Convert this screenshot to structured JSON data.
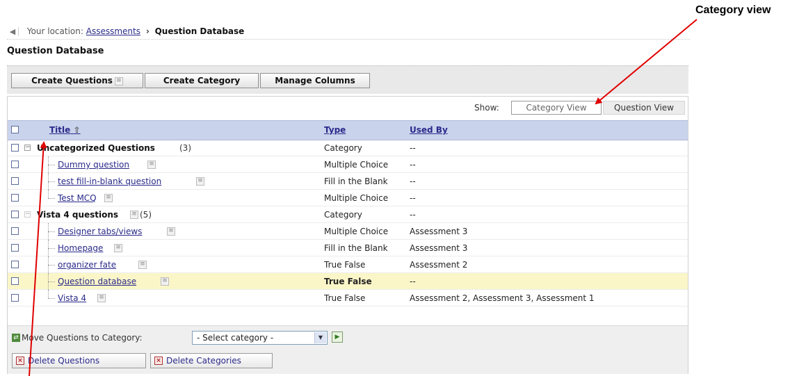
{
  "breadcrumb": {
    "prefix": "Your location:",
    "parent": "Assessments",
    "separator": "›",
    "current": "Question Database"
  },
  "page_title": "Question Database",
  "toolbar": {
    "create_questions": "Create Questions",
    "create_category": "Create Category",
    "manage_columns": "Manage Columns"
  },
  "show": {
    "label": "Show:",
    "category_view": "Category View",
    "question_view": "Question View"
  },
  "columns": {
    "title": "Title",
    "type": "Type",
    "used_by": "Used By"
  },
  "rows": [
    {
      "title": "Uncategorized Questions",
      "count": "(3)",
      "type": "Category",
      "used_by": "--"
    },
    {
      "title": "Dummy question",
      "type": "Multiple Choice",
      "used_by": "--"
    },
    {
      "title": "test fill-in-blank question",
      "type": "Fill in the Blank",
      "used_by": "--"
    },
    {
      "title": "Test MCQ",
      "type": "Multiple Choice",
      "used_by": "--"
    },
    {
      "title": "Vista 4 questions",
      "count": "(5)",
      "type": "Category",
      "used_by": "--"
    },
    {
      "title": "Designer tabs/views",
      "type": "Multiple Choice",
      "used_by": "Assessment 3"
    },
    {
      "title": "Homepage",
      "type": "Fill in the Blank",
      "used_by": "Assessment 3"
    },
    {
      "title": "organizer fate",
      "type": "True False",
      "used_by": "Assessment 2"
    },
    {
      "title": "Question database",
      "type": "True False",
      "used_by": "--"
    },
    {
      "title": "Vista 4",
      "type": "True False",
      "used_by": "Assessment 2, Assessment 3, Assessment 1"
    }
  ],
  "bottom": {
    "move_label": "Move Questions to Category:",
    "select_value": "- Select category -",
    "delete_questions": "Delete Questions",
    "delete_categories": "Delete Categories"
  },
  "annotation": {
    "label": "Category view",
    "color": "#e00000"
  }
}
